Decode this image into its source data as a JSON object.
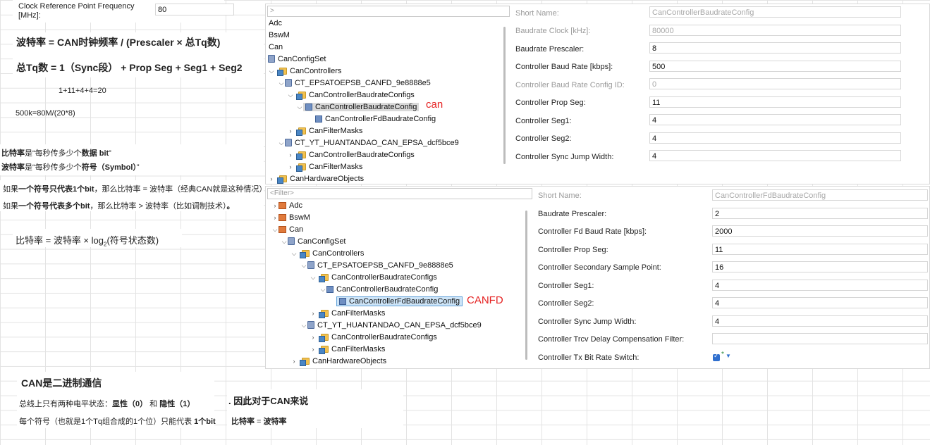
{
  "sheet": {
    "clock_label": "Clock Reference Point Frequency [MHz]:",
    "clock_value": "80",
    "formula1": "波特率 = CAN时钟频率 / (Prescaler × 总Tq数)",
    "formula2": "总Tq数 = 1（Sync段） + Prop Seg + Seg1 + Seg2",
    "sum": "1+11+4+4=20",
    "calc": "500k=80M/(20*8)",
    "bitrate_def_a": "比特率",
    "bitrate_def_b": "是“每秒传多少个",
    "bitrate_def_c": "数据 bit",
    "bitrate_def_d": "”",
    "baud_def_a": "波特率",
    "baud_def_b": "是“每秒传多少个",
    "baud_def_c": "符号（Symbol）",
    "baud_def_d": "”",
    "line_one_bit_a": "如果",
    "line_one_bit_b": "一个符号只代表1个bit",
    "line_one_bit_c": "，那么比特率 = 波特率（经典CAN就是这种情况）",
    "line_multi_bit_a": "如果",
    "line_multi_bit_b": "一个符号代表多个bit",
    "line_multi_bit_c": "，那么比特率 > 波特率（比如调制技术）",
    "line_multi_bit_d": "。",
    "log_formula_a": "比特率 = 波特率 × log",
    "log_formula_sub": "2",
    "log_formula_b": "(符号状态数)",
    "can_binary_title": "CAN是二进制通信",
    "bus_levels_a": "总线上只有两种电平状态：",
    "bus_levels_b": "显性（0）",
    "bus_levels_c": " 和 ",
    "bus_levels_d": "隐性（1）",
    "symbol_a": "每个符号（也就是1个Tq组合成的1个位）只能代表 ",
    "symbol_b": "1个bit",
    "therefore": ". 因此对于CAN来说",
    "conclusion_a": "比特率",
    "conclusion_b": " = ",
    "conclusion_c": "波特率"
  },
  "tree1": {
    "filter": ">",
    "items": [
      {
        "label": "Adc"
      },
      {
        "label": "BswM"
      },
      {
        "label": "Can"
      },
      {
        "label": "CanConfigSet"
      },
      {
        "label": "CanControllers"
      },
      {
        "label": "CT_EPSATOEPSB_CANFD_9e8888e5"
      },
      {
        "label": "CanControllerBaudrateConfigs"
      },
      {
        "label": "CanControllerBaudrateConfig"
      },
      {
        "label": "CanControllerFdBaudrateConfig"
      },
      {
        "label": "CanFilterMasks"
      },
      {
        "label": "CT_YT_HUANTANDAO_CAN_EPSA_dcf5bce9"
      },
      {
        "label": "CanControllerBaudrateConfigs"
      },
      {
        "label": "CanFilterMasks"
      },
      {
        "label": "CanHardwareObjects"
      }
    ],
    "tag": "can"
  },
  "props1": {
    "rows": [
      {
        "label": "Short Name:",
        "value": "CanControllerBaudrateConfig"
      },
      {
        "label": "Baudrate Clock [kHz]:",
        "value": "80000"
      },
      {
        "label": "Baudrate Prescaler:",
        "value": "8"
      },
      {
        "label": "Controller Baud Rate [kbps]:",
        "value": "500"
      },
      {
        "label": "Controller Baud Rate Config ID:",
        "value": "0"
      },
      {
        "label": "Controller Prop Seg:",
        "value": "11"
      },
      {
        "label": "Controller Seg1:",
        "value": "4"
      },
      {
        "label": "Controller Seg2:",
        "value": "4"
      },
      {
        "label": "Controller Sync Jump Width:",
        "value": "4"
      }
    ]
  },
  "tree2": {
    "filter": "<Filter>",
    "items": [
      {
        "label": "Adc"
      },
      {
        "label": "BswM"
      },
      {
        "label": "Can"
      },
      {
        "label": "CanConfigSet"
      },
      {
        "label": "CanControllers"
      },
      {
        "label": "CT_EPSATOEPSB_CANFD_9e8888e5"
      },
      {
        "label": "CanControllerBaudrateConfigs"
      },
      {
        "label": "CanControllerBaudrateConfig"
      },
      {
        "label": "CanControllerFdBaudrateConfig"
      },
      {
        "label": "CanFilterMasks"
      },
      {
        "label": "CT_YT_HUANTANDAO_CAN_EPSA_dcf5bce9"
      },
      {
        "label": "CanControllerBaudrateConfigs"
      },
      {
        "label": "CanFilterMasks"
      },
      {
        "label": "CanHardwareObjects"
      }
    ],
    "tag": "CANFD"
  },
  "props2": {
    "rows": [
      {
        "label": "Short Name:",
        "value": "CanControllerFdBaudrateConfig"
      },
      {
        "label": "Baudrate Prescaler:",
        "value": "2"
      },
      {
        "label": "Controller Fd Baud Rate [kbps]:",
        "value": "2000"
      },
      {
        "label": "Controller Prop Seg:",
        "value": "11"
      },
      {
        "label": "Controller Secondary Sample Point:",
        "value": "16"
      },
      {
        "label": "Controller Seg1:",
        "value": "4"
      },
      {
        "label": "Controller Seg2:",
        "value": "4"
      },
      {
        "label": "Controller Sync Jump Width:",
        "value": "4"
      },
      {
        "label": "Controller Trcv Delay Compensation Filter:",
        "value": ""
      },
      {
        "label": "Controller Tx Bit Rate Switch:",
        "value": ""
      }
    ]
  },
  "colors": {
    "accent": "#2f6fce",
    "annotation": "#e52222",
    "selection": "#cde4f7"
  }
}
